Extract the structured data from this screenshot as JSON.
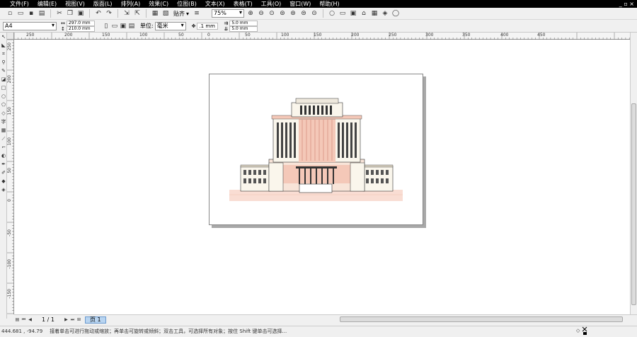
{
  "menubar": {
    "items": [
      "文件(F)",
      "编辑(E)",
      "视图(V)",
      "版面(L)",
      "排列(A)",
      "效果(C)",
      "位图(B)",
      "文本(X)",
      "表格(T)",
      "工具(O)",
      "窗口(W)",
      "帮助(H)"
    ],
    "window_controls": "_ ▫ ×"
  },
  "toolbar": {
    "zoom_value": "75%",
    "snap_label": "贴齐"
  },
  "propertybar": {
    "paper_size": "A4",
    "width": "297.0 mm",
    "height": "210.0 mm",
    "unit_label": "单位:",
    "unit_value": "毫米",
    "nudge_value": ".1 mm",
    "dup_x": "5.0 mm",
    "dup_y": "5.0 mm"
  },
  "ruler": {
    "h_ticks": [
      "250",
      "200",
      "150",
      "100",
      "50",
      "0",
      "50",
      "100",
      "150",
      "200",
      "250",
      "300",
      "350",
      "400",
      "450"
    ],
    "v_ticks": [
      "250",
      "200",
      "150",
      "100",
      "50",
      "0",
      "-50",
      "-100",
      "-150"
    ]
  },
  "pagenav": {
    "page_count": "1 / 1",
    "page_tab": "页 1"
  },
  "status": {
    "coords": "444.681 , -94.79",
    "message": "接着单击可进行拖动或缩放；再单击可旋转或倾斜；双击工具，可选择所有对象；按住 Shift 键单击可选择..."
  },
  "colors": {
    "menubar_bg": "#000000",
    "page_tab": "#b8d4f0",
    "building_facade": "#f4c8b8",
    "building_outline": "#333333"
  }
}
